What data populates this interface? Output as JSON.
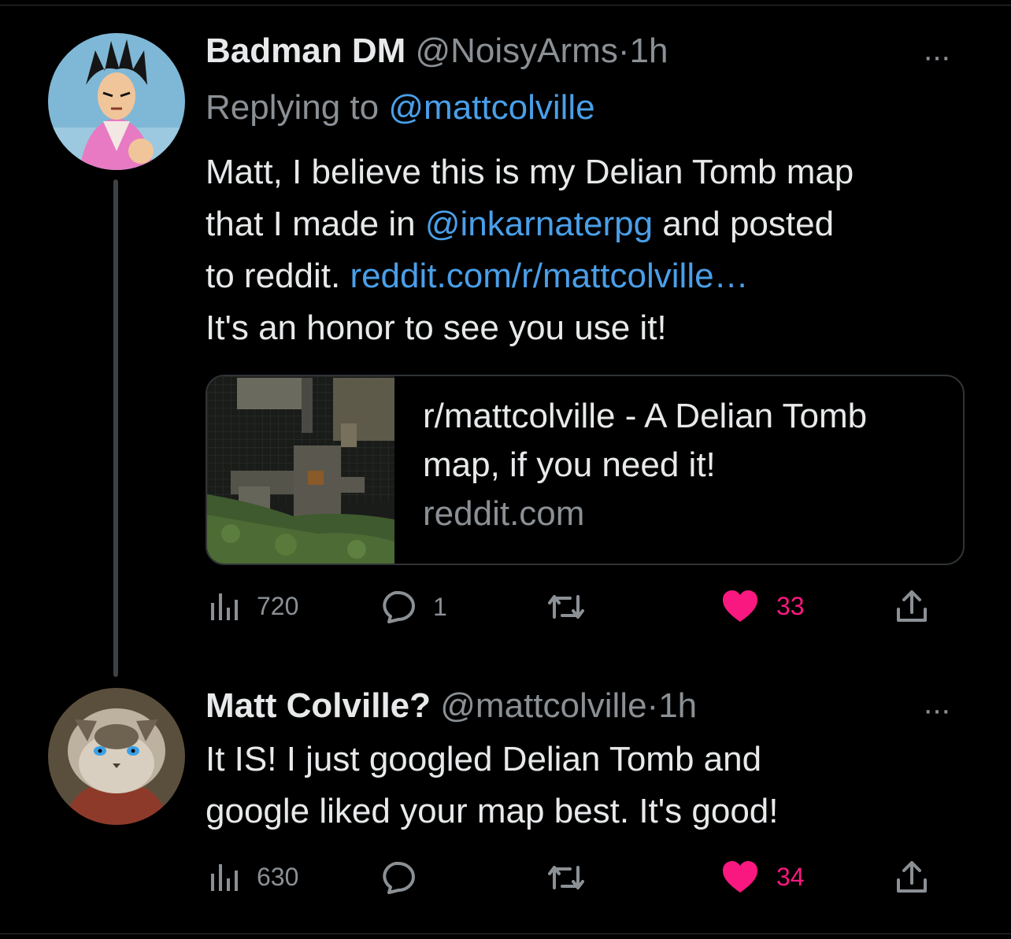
{
  "tweet1": {
    "name": "Badman DM",
    "handle": "@NoisyArms",
    "sep": "·",
    "time": "1h",
    "more": "···",
    "replying_prefix": "Replying to",
    "replying_handle": "@mattcolville",
    "body": {
      "l1": "Matt, I believe this is my Delian Tomb map",
      "l2a": "that I made in ",
      "l2link": "@inkarnaterpg",
      "l2b": " and posted",
      "l3a": "to reddit. ",
      "l3link": "reddit.com/r/mattcolville…",
      "l4": "It's an honor to see you use it!"
    },
    "card": {
      "title": "r/mattcolville - A Delian Tomb map, if you need it!",
      "domain": "reddit.com"
    },
    "actions": {
      "views": "720",
      "replies": "1",
      "retweets": "",
      "likes": "33"
    }
  },
  "tweet2": {
    "name": "Matt Colville?",
    "handle": "@mattcolville",
    "sep": "·",
    "time": "1h",
    "more": "···",
    "body": {
      "l1": "It IS! I just googled Delian Tomb and",
      "l2": "google liked your map best. It's good!"
    },
    "actions": {
      "views": "630",
      "replies": "",
      "retweets": "",
      "likes": "34"
    }
  },
  "colors": {
    "background": "#000000",
    "text": "#e7e9ea",
    "muted": "#8b9095",
    "link": "#4a9fe8",
    "like": "#f91880",
    "divider": "#2f3336"
  }
}
